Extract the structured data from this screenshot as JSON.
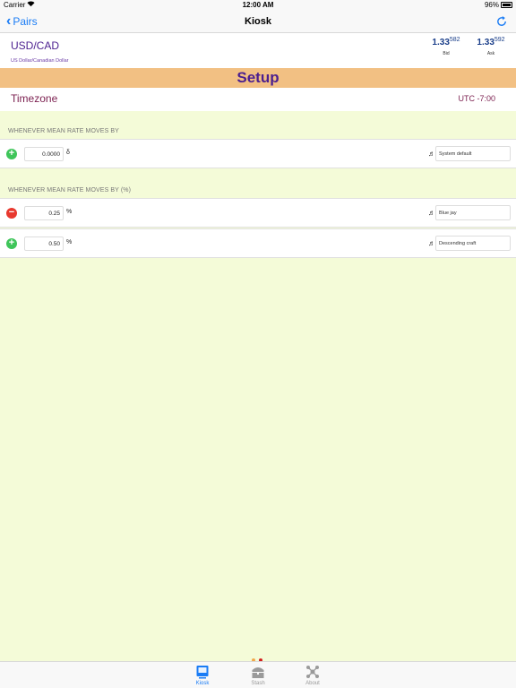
{
  "status_bar": {
    "carrier": "Carrier",
    "time": "12:00 AM",
    "battery": "96%"
  },
  "nav": {
    "back_label": "Pairs",
    "title": "Kiosk"
  },
  "pair": {
    "symbol": "USD/CAD",
    "description": "US Dollar/Canadian Dollar",
    "bid": {
      "main": "1.33",
      "pips": "582",
      "label": "Bid"
    },
    "ask": {
      "main": "1.33",
      "pips": "592",
      "label": "Ask"
    }
  },
  "setup": {
    "title": "Setup"
  },
  "timezone": {
    "label": "Timezone",
    "value": "UTC -7:00"
  },
  "sections": {
    "absolute": {
      "header": "WHENEVER MEAN RATE MOVES BY",
      "rows": [
        {
          "value": "0.0000",
          "unit": "δ",
          "sound": "System default",
          "action": "add"
        }
      ]
    },
    "percent": {
      "header": "WHENEVER MEAN RATE MOVES BY (%)",
      "rows": [
        {
          "value": "0.25",
          "unit": "%",
          "sound": "Blue jay",
          "action": "remove"
        },
        {
          "value": "0.50",
          "unit": "%",
          "sound": "Descending craft",
          "action": "add"
        }
      ]
    }
  },
  "tabs": [
    {
      "label": "Kiosk",
      "active": true
    },
    {
      "label": "Stash",
      "active": false
    },
    {
      "label": "About",
      "active": false
    }
  ],
  "colors": {
    "accent": "#1a7cf5",
    "background": "#f4fbd8",
    "banner": "#f2c083",
    "pair_text": "#4b1f8f",
    "add": "#3fc55a",
    "remove": "#e8392f"
  }
}
